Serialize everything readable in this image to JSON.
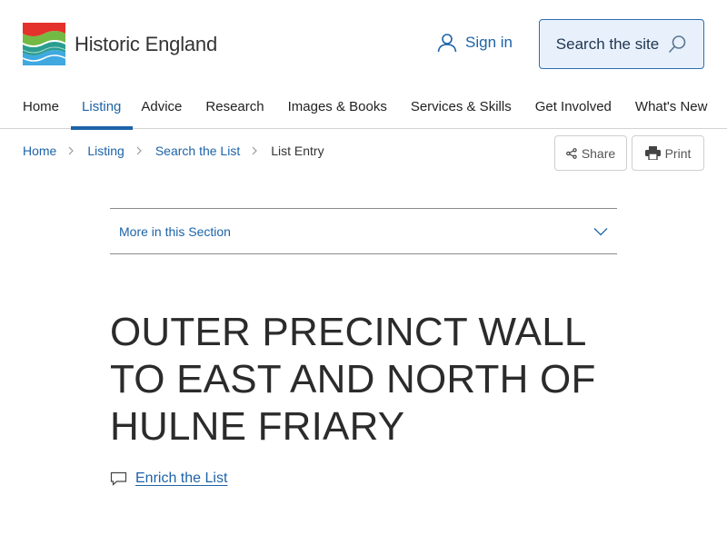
{
  "brand": {
    "name": "Historic England",
    "icon": "historic-england-logo"
  },
  "header": {
    "sign_in_label": "Sign in",
    "sign_in_icon": "user-icon",
    "search_label": "Search the site",
    "search_icon": "search-icon"
  },
  "nav": {
    "items": [
      {
        "label": "Home"
      },
      {
        "label": "Listing",
        "active": true
      },
      {
        "label": "Advice"
      },
      {
        "label": "Research"
      },
      {
        "label": "Images & Books"
      },
      {
        "label": "Services & Skills"
      },
      {
        "label": "Get Involved"
      },
      {
        "label": "What's New"
      }
    ]
  },
  "breadcrumb": {
    "items": [
      "Home",
      "Listing",
      "Search the List"
    ],
    "current": "List Entry"
  },
  "actions": {
    "share_label": "Share",
    "print_label": "Print"
  },
  "section_menu": {
    "label": "More in this Section"
  },
  "entry": {
    "title": "OUTER PRECINCT WALL TO EAST AND NORTH OF HULNE FRIARY",
    "enrich_label": "Enrich the List"
  },
  "colors": {
    "accent": "#1d63a8",
    "search_bg": "#e8f1fb",
    "text": "#222222"
  }
}
